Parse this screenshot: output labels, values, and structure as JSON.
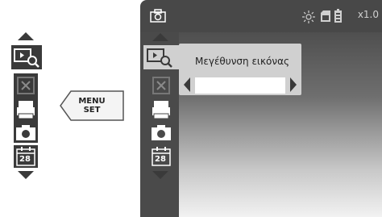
{
  "key": {
    "line1": "MENU",
    "line2": "SET"
  },
  "screen": {
    "status": {
      "zoom": "x1.0"
    },
    "panel": {
      "title": "Μεγέθυνση εικόνας",
      "value": ""
    }
  },
  "menu_items": [
    {
      "name": "image-zoom",
      "icon": "zoom-icon"
    },
    {
      "name": "scissors",
      "icon": "scissors-icon"
    },
    {
      "name": "printer",
      "icon": "printer-icon"
    },
    {
      "name": "camera",
      "icon": "camera-icon"
    },
    {
      "name": "calendar",
      "icon": "calendar-icon",
      "number": "28"
    }
  ]
}
